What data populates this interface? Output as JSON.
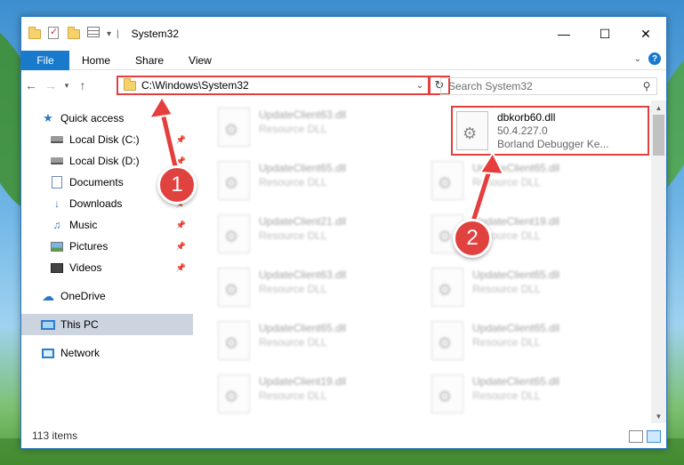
{
  "window": {
    "title": "System32"
  },
  "ribbon": {
    "tabs": [
      "File",
      "Home",
      "Share",
      "View"
    ]
  },
  "address": {
    "path": "C:\\Windows\\System32",
    "search_placeholder": "Search System32"
  },
  "sidebar": {
    "items": [
      {
        "label": "Quick access",
        "icon": "star-icon"
      },
      {
        "label": "Local Disk (C:)",
        "icon": "drive-icon"
      },
      {
        "label": "Local Disk (D:)",
        "icon": "drive-icon"
      },
      {
        "label": "Documents",
        "icon": "documents-icon"
      },
      {
        "label": "Downloads",
        "icon": "downloads-icon"
      },
      {
        "label": "Music",
        "icon": "music-icon"
      },
      {
        "label": "Pictures",
        "icon": "pictures-icon"
      },
      {
        "label": "Videos",
        "icon": "videos-icon"
      },
      {
        "label": "OneDrive",
        "icon": "onedrive-icon"
      },
      {
        "label": "This PC",
        "icon": "this-pc-icon"
      },
      {
        "label": "Network",
        "icon": "network-icon"
      }
    ]
  },
  "files": [
    {
      "name": "UpdateClient63.dll",
      "desc": "Resource DLL"
    },
    {
      "name": "UpdateClient65.dll",
      "desc": "Resource DLL"
    },
    {
      "name": "UpdateClient21.dll",
      "desc": "Resource DLL"
    },
    {
      "name": "UpdateClient63.dll",
      "desc": "Resource DLL"
    },
    {
      "name": "UpdateClient65.dll",
      "desc": "Resource DLL"
    },
    {
      "name": "UpdateClient19.dll",
      "desc": "Resource DLL"
    },
    {
      "name": "UpdateClient65.dll",
      "desc": "Resource DLL"
    },
    {
      "name": "UpdateClient19.dll",
      "desc": "Resource DLL"
    },
    {
      "name": "UpdateClient65.dll",
      "desc": "Resource DLL"
    },
    {
      "name": "UpdateClient65.dll",
      "desc": "Resource DLL"
    },
    {
      "name": "UpdateClient65.dll",
      "desc": "Resource DLL"
    }
  ],
  "highlighted_file": {
    "name": "dbkorb60.dll",
    "version": "50.4.227.0",
    "description": "Borland Debugger Ke..."
  },
  "status": {
    "item_count": "113 items"
  },
  "annotations": {
    "step1": "1",
    "step2": "2"
  },
  "colors": {
    "accent": "#1979ca",
    "annotation_red": "#e53e3e"
  }
}
